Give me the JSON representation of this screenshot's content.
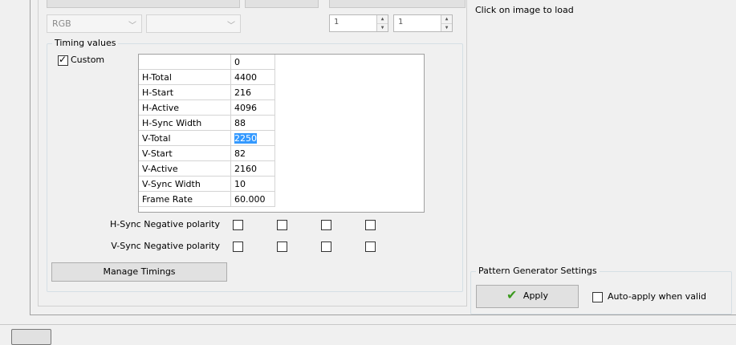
{
  "top": {
    "color_format": "RGB",
    "second_combo": "",
    "spin_a": "1",
    "spin_b": "1"
  },
  "preview": {
    "hint": "Click on image to load"
  },
  "timing": {
    "group_title": "Timing values",
    "custom_label": "Custom",
    "custom_checked": true,
    "column_header": "0",
    "rows": [
      {
        "label": "H-Total",
        "value": "4400"
      },
      {
        "label": "H-Start",
        "value": "216"
      },
      {
        "label": "H-Active",
        "value": "4096"
      },
      {
        "label": "H-Sync Width",
        "value": "88"
      },
      {
        "label": "V-Total",
        "value": "2250",
        "selected": true
      },
      {
        "label": "V-Start",
        "value": "82"
      },
      {
        "label": "V-Active",
        "value": "2160"
      },
      {
        "label": "V-Sync Width",
        "value": "10"
      },
      {
        "label": "Frame Rate",
        "value": "60.000"
      }
    ],
    "hsync_label": "H-Sync Negative polarity",
    "vsync_label": "V-Sync Negative polarity",
    "manage_button": "Manage Timings"
  },
  "pattern": {
    "group_title": "Pattern Generator Settings",
    "apply_label": "Apply",
    "auto_apply_label": "Auto-apply when valid"
  },
  "icons": {
    "apply": "checkmark-icon",
    "spin_up": "spin-up-icon",
    "spin_down": "spin-down-icon",
    "chevron": "chevron-down-icon"
  },
  "colors": {
    "selection": "#3399ff",
    "check_green": "#3c9a1f",
    "window_bg": "#f0f0f0"
  }
}
